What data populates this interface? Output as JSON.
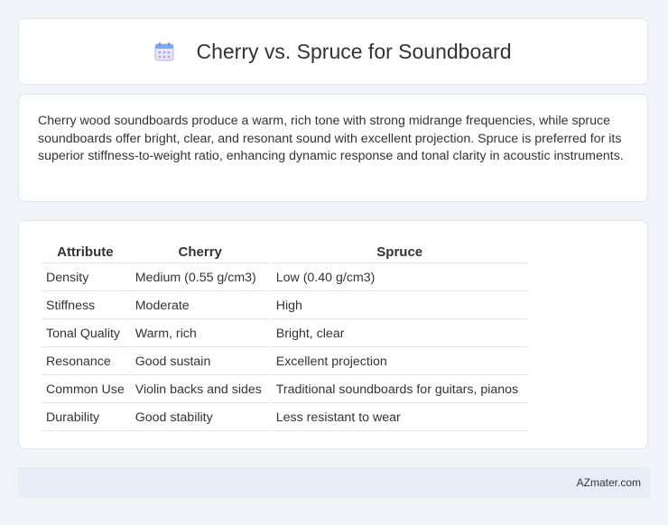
{
  "header": {
    "title": "Cherry vs. Spruce for Soundboard",
    "icon": "calendar-icon"
  },
  "description": "Cherry wood soundboards produce a warm, rich tone with strong midrange frequencies, while spruce soundboards offer bright, clear, and resonant sound with excellent projection. Spruce is preferred for its superior stiffness-to-weight ratio, enhancing dynamic response and tonal clarity in acoustic instruments.",
  "table": {
    "columns": [
      "Attribute",
      "Cherry",
      "Spruce"
    ],
    "rows": [
      [
        "Density",
        "Medium (0.55 g/cm3)",
        "Low (0.40 g/cm3)"
      ],
      [
        "Stiffness",
        "Moderate",
        "High"
      ],
      [
        "Tonal Quality",
        "Warm, rich",
        "Bright, clear"
      ],
      [
        "Resonance",
        "Good sustain",
        "Excellent projection"
      ],
      [
        "Common Use",
        "Violin backs and sides",
        "Traditional soundboards for guitars, pianos"
      ],
      [
        "Durability",
        "Good stability",
        "Less resistant to wear"
      ]
    ]
  },
  "footer": {
    "text": "AZmater.com"
  }
}
